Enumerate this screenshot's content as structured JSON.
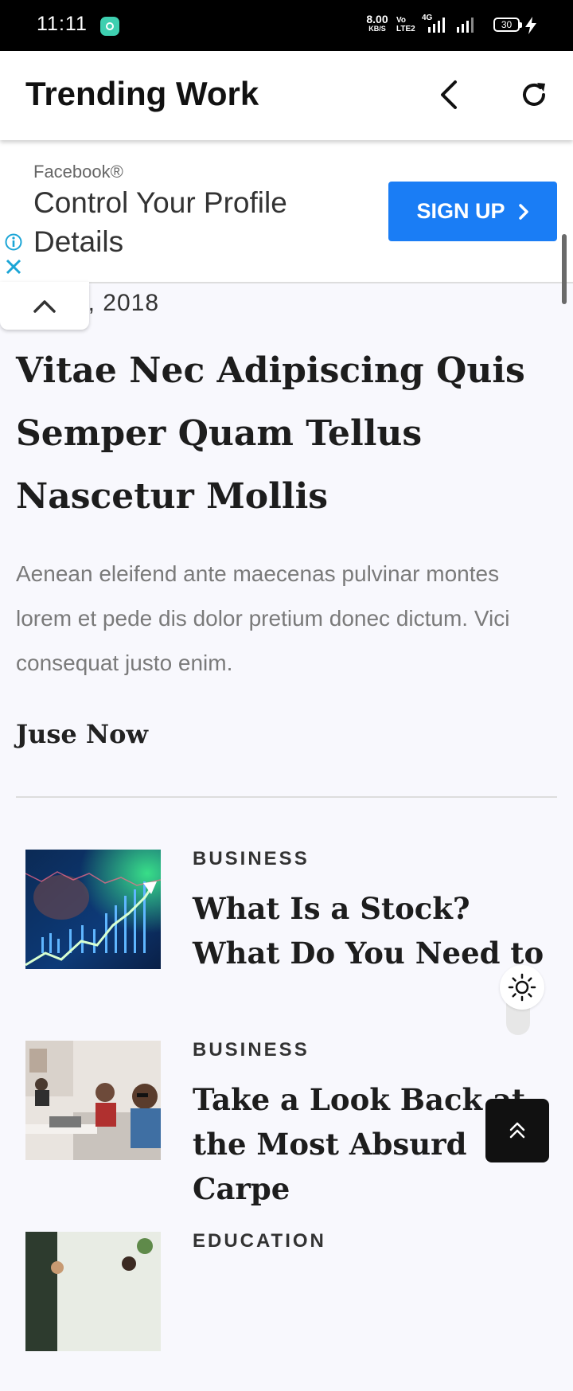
{
  "status_bar": {
    "time": "11:11",
    "net_speed_value": "8.00",
    "net_speed_unit": "KB/S",
    "volte_top": "Vo",
    "volte_bottom": "LTE2",
    "network_type": "4G",
    "battery": "30"
  },
  "header": {
    "title": "Trending Work",
    "back_icon": "chevron-left-icon",
    "refresh_icon": "refresh-icon"
  },
  "ad": {
    "brand": "Facebook®",
    "headline": "Control Your Profile Details",
    "cta_label": "SIGN UP",
    "accent": "#1a7df5"
  },
  "article": {
    "date_visible": "ARY 3, 2018",
    "title": "Vitae Nec Adipiscing Quis Semper Quam Tellus Nascetur Mollis",
    "excerpt": "Aenean eleifend ante maecenas pulvinar montes lorem et pede dis dolor pretium donec dictum. Vici consequat justo enim.",
    "read_link": "Juse Now"
  },
  "posts": [
    {
      "category": "BUSINESS",
      "title": "What Is a Stock? What Do You Need to",
      "image": "stock-chart"
    },
    {
      "category": "BUSINESS",
      "title": "Take a Look Back at the Most Absurd Carpe",
      "image": "office-people"
    },
    {
      "category": "EDUCATION",
      "title": "",
      "image": "classroom"
    }
  ]
}
